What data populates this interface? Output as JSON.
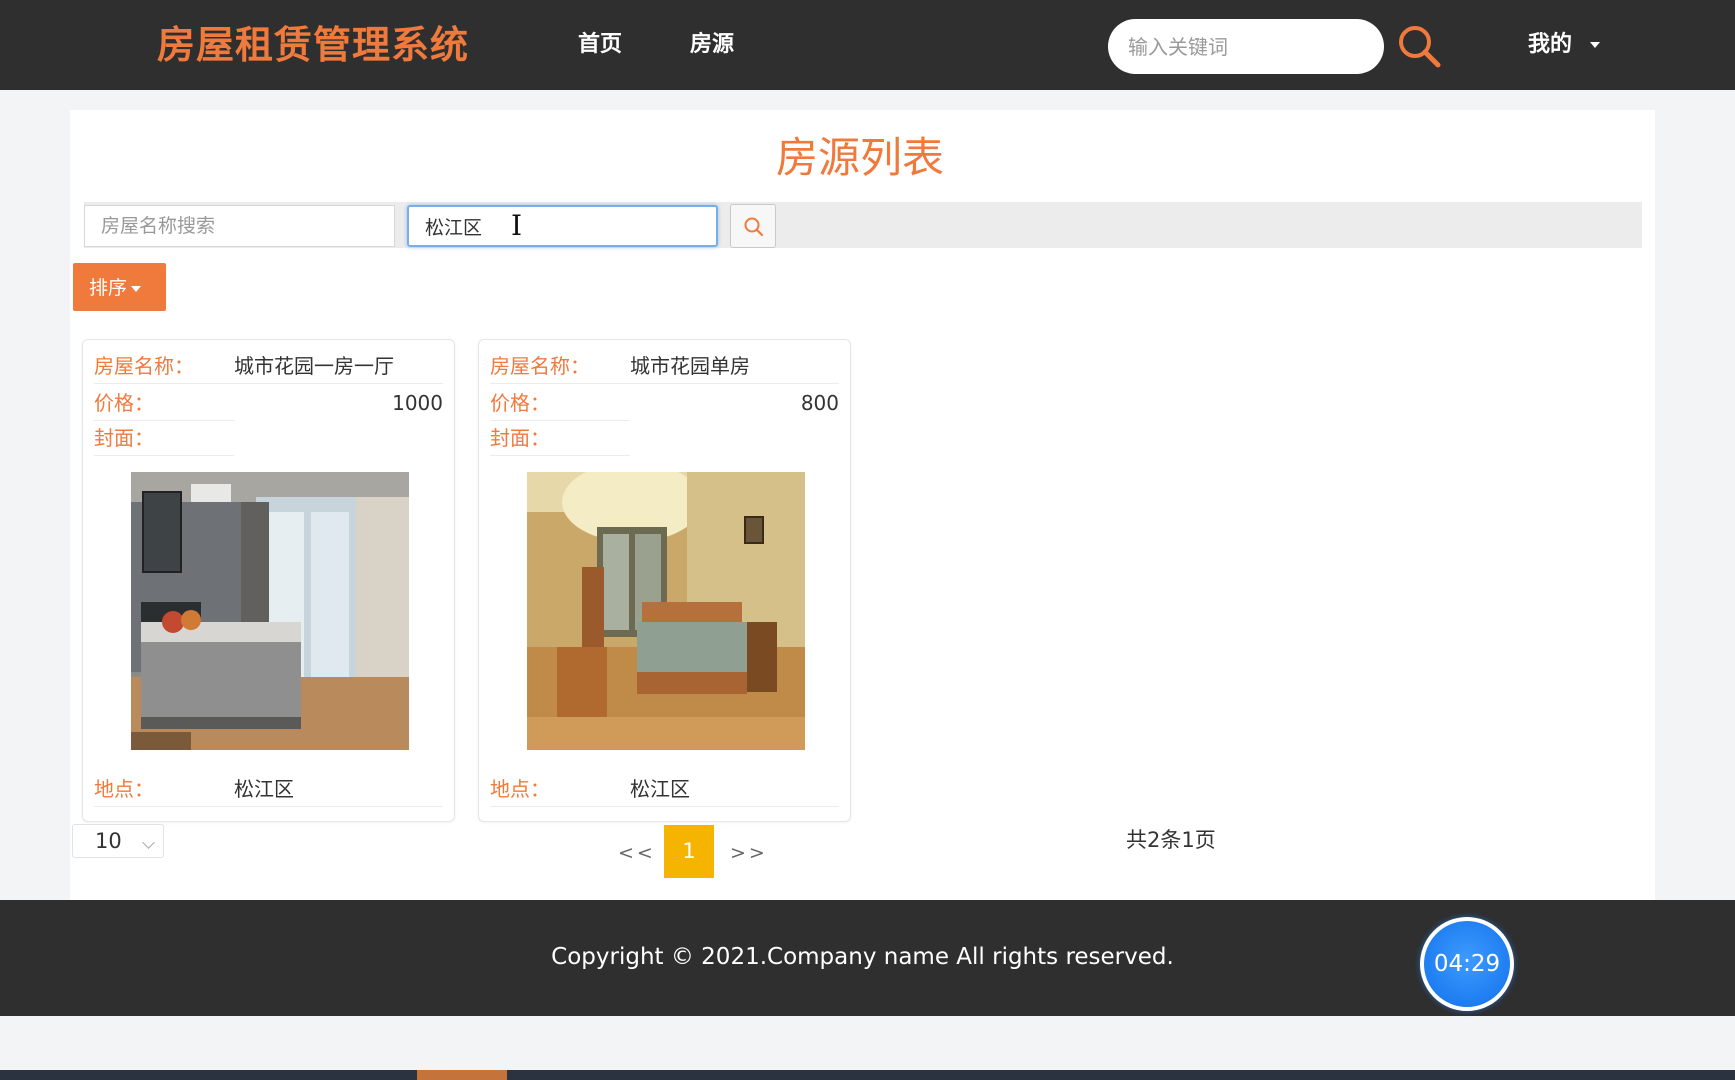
{
  "header": {
    "brand": "房屋租赁管理系统",
    "nav": [
      "首页",
      "房源"
    ],
    "search_placeholder": "输入关键词",
    "user_menu": "我的"
  },
  "main": {
    "title": "房源列表",
    "filters": {
      "name_placeholder": "房屋名称搜索",
      "location_value": "松江区"
    },
    "sort_label": "排序",
    "cards": [
      {
        "name_label": "房屋名称：",
        "name": "城市花园一房一厅",
        "price_label": "价格：",
        "price": "1000",
        "cover_label": "封面：",
        "location_label": "地点：",
        "location": "松江区"
      },
      {
        "name_label": "房屋名称：",
        "name": "城市花园单房",
        "price_label": "价格：",
        "price": "800",
        "cover_label": "封面：",
        "location_label": "地点：",
        "location": "松江区"
      }
    ],
    "pagination": {
      "page_size": "10",
      "prev": "<<",
      "current": "1",
      "next": ">>",
      "total": "共2条1页"
    }
  },
  "footer": {
    "copyright": "Copyright © 2021.Company name All rights reserved."
  },
  "timer": "04:29",
  "colors": {
    "accent": "#f07a3c",
    "header_bg": "#2f2f2f",
    "pager_active": "#f5b400",
    "timer": "#1e7df0"
  }
}
